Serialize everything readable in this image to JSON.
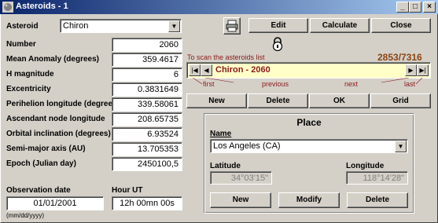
{
  "window": {
    "title": "Asteroids - 1",
    "controls": [
      "_",
      "□",
      "×"
    ]
  },
  "asteroid": {
    "label": "Asteroid",
    "selected": "Chiron"
  },
  "fields": [
    {
      "label": "Number",
      "value": "2060"
    },
    {
      "label": "Mean Anomaly (degrees)",
      "value": "359.4617"
    },
    {
      "label": "H magnitude",
      "value": "6"
    },
    {
      "label": "Excentricity",
      "value": "0.3831649"
    },
    {
      "label": "Perihelion longitude (degrees)",
      "value": "339.58061"
    },
    {
      "label": "Ascendant node longitude",
      "value": "208.65735"
    },
    {
      "label": "Orbital inclination (degrees)",
      "value": "6.93524"
    },
    {
      "label": "Semi-major axis (AU)",
      "value": "13.705353"
    },
    {
      "label": "Epoch (Julian day)",
      "value": "2450100,5"
    }
  ],
  "observation": {
    "date_label": "Observation date",
    "date_value": "01/01/2001",
    "hour_label": "Hour UT",
    "hour_value": "12h 00mn 00s",
    "date_format": "(mm/dd/yyyy)"
  },
  "toolbar": {
    "edit": "Edit",
    "calculate": "Calculate",
    "close": "Close"
  },
  "scan": {
    "hint": "To scan the asteroids list",
    "counter": "2853/7316",
    "current": "Chiron - 2060",
    "first": "first",
    "previous": "previous",
    "next": "next",
    "last": "last"
  },
  "actions": {
    "new": "New",
    "delete": "Delete",
    "ok": "OK",
    "grid": "Grid"
  },
  "place": {
    "title": "Place",
    "name_label": "Name",
    "name_value": "Los Angeles (CA)",
    "latitude_label": "Latitude",
    "latitude_value": "34°03'15\"",
    "longitude_label": "Longitude",
    "longitude_value": "118°14'28\"",
    "new": "New",
    "modify": "Modify",
    "delete": "Delete"
  },
  "icons": {
    "app": "asteroid-app-icon",
    "printer": "printer-icon",
    "lock": "padlock-icon"
  }
}
